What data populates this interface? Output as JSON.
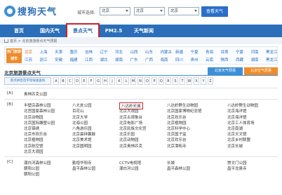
{
  "header": {
    "logo_text": "搜狗天气",
    "search_label": "城市选择:",
    "select_province": "北京",
    "select_city": "北京",
    "select_district": "北京",
    "search_button": "查看天气"
  },
  "nav": {
    "items": [
      "首页",
      "国内天气",
      "景点天气",
      "PM2.5",
      "天气新闻"
    ],
    "active_index": 2
  },
  "breadcrumb": "首页 > 北京旅游景点天气预报",
  "provinces": {
    "badge": "热门旅游城市",
    "row1": [
      "北京",
      "上海",
      "天津",
      "重庆",
      "吉林",
      "辽宁",
      "河北",
      "山西",
      "山东",
      "内蒙古",
      "新疆",
      "宁夏",
      "青海",
      "甘肃",
      "宁夏",
      "河南",
      "黑龙江"
    ],
    "row2": [
      "江苏",
      "浙江",
      "安徽",
      "福建",
      "江西",
      "湖北",
      "湖南",
      "广东",
      "广西",
      "海南",
      "四川",
      "贵州",
      "云南",
      "陕西",
      "西藏",
      "湖南",
      "黑龙江"
    ]
  },
  "section": {
    "title": "北京旅游景点天气",
    "tab_a": "北京天气预报",
    "tab_b": "北京空气质量"
  },
  "alpha_bar": {
    "label": "景点拼音首字母快速查询",
    "letters": [
      "A",
      "B",
      "C",
      "D",
      "E",
      "F",
      "G",
      "H",
      "J",
      "K",
      "L",
      "M",
      "N",
      "O",
      "P",
      "Q",
      "R",
      "S",
      "T",
      "W",
      "X",
      "Y",
      "Z"
    ]
  },
  "groups": [
    {
      "letter": "[A]",
      "spots": [
        [
          "奥林匹克公园"
        ]
      ]
    },
    {
      "letter": "[B]",
      "spots": [
        [
          "半壁店森林公园",
          "八大处公园",
          "八达岭长城",
          "八达岭野生动物园",
          "八达岭野生动物园"
        ],
        [
          "北宫国家森林公园",
          "百花山",
          "北京大观园",
          "北京国家博物纪念馆",
          "北京海洋馆"
        ],
        [
          "北京动物园",
          "北京大学",
          "北京古观象台",
          "北京欢乐谷",
          "北京海洋馆"
        ],
        [
          "北京国际雕塑公园",
          "北海公园",
          "北京电影广场",
          "北京植物园",
          "北京工人体育场"
        ],
        [
          "北京锦绣",
          "八角游乐园",
          "北京民族文化宫",
          "北京科学中心",
          "北京南湖"
        ],
        [
          "北京市欢乐谷",
          "北京晨钟暮鼓",
          "北京乐园",
          "北京国子监",
          "北京天文馆"
        ],
        [
          "北京植物园",
          "北京美术馆",
          "北京动物园",
          "北京欢乐谷",
          "北京乡村联盟"
        ],
        [
          "北京航空馆",
          "北京圆明园",
          "北京奥林匹克",
          "北京潭柘寺",
          "北京长城"
        ],
        [
          "北京大观园"
        ]
      ]
    },
    {
      "letter": "[C]",
      "spots": [
        [
          "潮白河森林公园",
          "勤增华阳寺",
          "CCTV电视塔",
          "长城",
          "崇文门公园"
        ],
        [
          "朝阳公园",
          "昌平森林公园",
          "潮白河公园",
          "昌平森林公园",
          "昌平龙泉寺"
        ],
        [
          "朝阳公园"
        ]
      ]
    }
  ]
}
